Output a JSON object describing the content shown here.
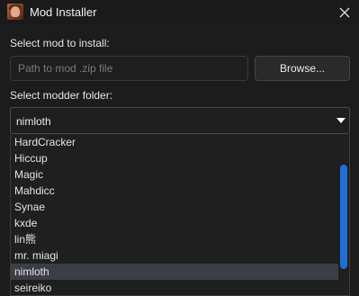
{
  "window": {
    "title": "Mod Installer"
  },
  "mod_section": {
    "label": "Select mod to install:",
    "path_placeholder": "Path to mod .zip file",
    "path_value": "",
    "browse_label": "Browse..."
  },
  "folder_section": {
    "label": "Select modder folder:",
    "selected": "nimloth"
  },
  "dropdown": {
    "items": [
      "HardCracker",
      "Hiccup",
      "Magic",
      "Mahdicc",
      "Synae",
      "kxde",
      "lin熊",
      "mr. miagi",
      "nimloth",
      "seireiko"
    ],
    "selected_index": 8
  },
  "colors": {
    "accent": "#1f6fd6",
    "background": "#1c1c1c",
    "selected_row": "#3b3f45"
  }
}
